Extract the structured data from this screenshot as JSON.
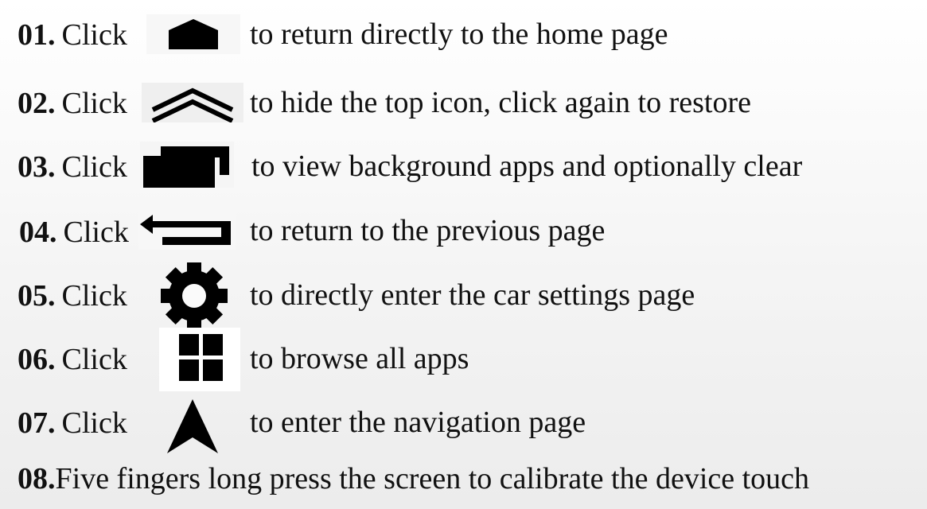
{
  "items": [
    {
      "num": "01.",
      "click": "Click",
      "icon": "home-icon",
      "text": "to return directly to the home page"
    },
    {
      "num": "02.",
      "click": "Click",
      "icon": "double-chevron-up-icon",
      "text": "to hide the top icon, click again to restore"
    },
    {
      "num": "03.",
      "click": "Click",
      "icon": "recent-apps-icon",
      "text": "to view background apps and optionally clear"
    },
    {
      "num": "04.",
      "click": "Click",
      "icon": "back-arrow-icon",
      "text": "to  return to the previous page"
    },
    {
      "num": "05.",
      "click": "Click",
      "icon": "gear-icon",
      "text": "to directly enter the car settings page"
    },
    {
      "num": "06.",
      "click": "Click",
      "icon": "app-grid-icon",
      "text": "to browse all apps"
    },
    {
      "num": "07.",
      "click": "Click",
      "icon": "navigation-arrow-icon",
      "text": "to  enter the navigation page"
    }
  ],
  "last": {
    "num": "08.",
    "text": "Five fingers long press the screen to calibrate the device touch"
  }
}
